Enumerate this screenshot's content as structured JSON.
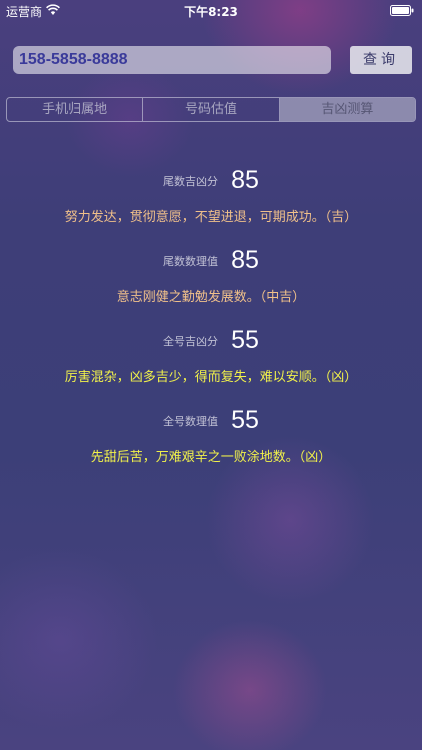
{
  "status_bar": {
    "carrier": "运营商",
    "time": "下午8:23",
    "wifi_icon": "wifi-icon",
    "battery_icon": "battery-icon"
  },
  "search": {
    "phone_number": "158-5858-8888",
    "query_button": "查询"
  },
  "tabs": [
    {
      "label": "手机归属地",
      "active": false
    },
    {
      "label": "号码估值",
      "active": false
    },
    {
      "label": "吉凶测算",
      "active": true
    }
  ],
  "results": [
    {
      "label": "尾数吉凶分",
      "value": "85",
      "text": "努力发达，贯彻意愿，不望进退，可期成功。（吉）",
      "color": "#f0c08a"
    },
    {
      "label": "尾数数理值",
      "value": "85",
      "text": "意志刚健之勤勉发展数。（中吉）",
      "color": "#f0c08a"
    },
    {
      "label": "全号吉凶分",
      "value": "55",
      "text": "厉害混杂，凶多吉少，得而复失，难以安顺。（凶）",
      "color": "#f2f24a"
    },
    {
      "label": "全号数理值",
      "value": "55",
      "text": "先甜后苦，万难艰辛之一败涂地数。（凶）",
      "color": "#f2f24a"
    }
  ]
}
